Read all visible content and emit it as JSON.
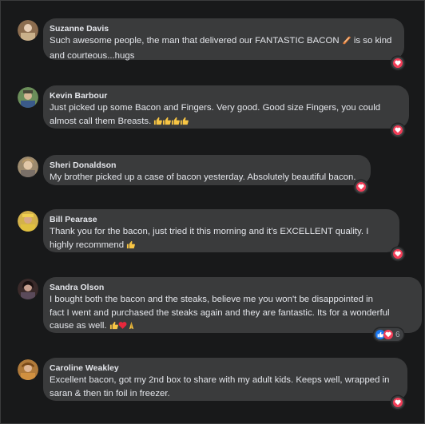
{
  "comments": [
    {
      "name": "Suzanne Davis",
      "lines": [
        "Such awesome people, the man that delivered our FANTASTIC BACON",
        "and courteous...hugs"
      ],
      "line1_after_emoji": "is so kind",
      "emojis": [
        "bacon-emoji"
      ],
      "reactions": [
        "heart"
      ],
      "reaction_count": "",
      "avatar_color": "#8c6d4f"
    },
    {
      "name": "Kevin Barbour",
      "lines": [
        "Just picked up some Bacon and Fingers. Very good. Good size Fingers, you could",
        "almost call them Breasts."
      ],
      "emojis": [
        "thumbs-up-emoji",
        "thumbs-up-emoji",
        "thumbs-up-emoji",
        "thumbs-up-emoji"
      ],
      "reactions": [
        "heart"
      ],
      "reaction_count": "",
      "avatar_color": "#6b8e5a"
    },
    {
      "name": "Sheri Donaldson",
      "lines": [
        "My brother picked up a case of bacon yesterday. Absolutely beautiful bacon."
      ],
      "emojis": [],
      "reactions": [
        "heart"
      ],
      "reaction_count": "",
      "avatar_color": "#9c8a6e"
    },
    {
      "name": "Bill Pearase",
      "lines": [
        "Thank you for the bacon, just tried it this morning and it's EXCELLENT quality. I",
        "highly recommend"
      ],
      "emojis": [
        "thumbs-up-emoji"
      ],
      "reactions": [
        "heart"
      ],
      "reaction_count": "",
      "avatar_color": "#d4b24a"
    },
    {
      "name": "Sandra Olson",
      "lines": [
        "I bought both the bacon and the steaks, believe me you won't be disappointed in",
        "fact I went and purchased the steaks again and they are fantastic. Its for a wonderful",
        "cause as well."
      ],
      "emojis": [
        "thumbs-up-emoji",
        "red-heart-emoji",
        "praying-emoji"
      ],
      "reactions": [
        "like",
        "heart"
      ],
      "reaction_count": "6",
      "avatar_color": "#3a2a2a"
    },
    {
      "name": "Caroline Weakley",
      "lines": [
        "Excellent bacon, got my 2nd box to share with my adult kids. Keeps well, wrapped in",
        "saran & then tin foil in freezer."
      ],
      "emojis": [],
      "reactions": [
        "heart"
      ],
      "reaction_count": "",
      "avatar_color": "#b07a3a"
    }
  ]
}
